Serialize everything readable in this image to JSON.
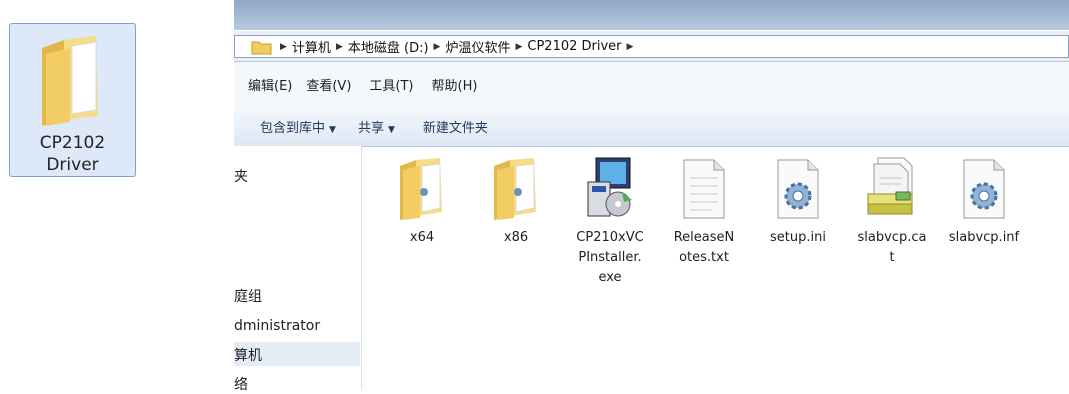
{
  "desktop_item": {
    "label_line1": "CP2102",
    "label_line2": "Driver",
    "icon": "folder-icon"
  },
  "address_bar": {
    "crumbs": [
      "计算机",
      "本地磁盘 (D:)",
      "炉温仪软件",
      "CP2102 Driver"
    ]
  },
  "menu": [
    "编辑(E)",
    "查看(V)",
    "工具(T)",
    "帮助(H)"
  ],
  "toolbar": {
    "include_library": "包含到库中",
    "share": "共享",
    "new_folder": "新建文件夹"
  },
  "nav_pane": {
    "items": [
      "夹",
      "庭组",
      "dministrator",
      "算机",
      "络"
    ]
  },
  "files": [
    {
      "name": "x64",
      "icon": "folder-icon"
    },
    {
      "name": "x86",
      "icon": "folder-icon"
    },
    {
      "name": "CP210xVCPInstaller.exe",
      "display": [
        "CP210xVC",
        "PInstaller.",
        "exe"
      ],
      "icon": "installer-icon"
    },
    {
      "name": "ReleaseNotes.txt",
      "display": [
        "ReleaseN",
        "otes.txt"
      ],
      "icon": "text-file-icon"
    },
    {
      "name": "setup.ini",
      "display": [
        "setup.ini"
      ],
      "icon": "settings-file-icon"
    },
    {
      "name": "slabvcp.cat",
      "display": [
        "slabvcp.ca",
        "t"
      ],
      "icon": "catalog-file-icon"
    },
    {
      "name": "slabvcp.inf",
      "display": [
        "slabvcp.inf"
      ],
      "icon": "settings-file-icon"
    }
  ]
}
